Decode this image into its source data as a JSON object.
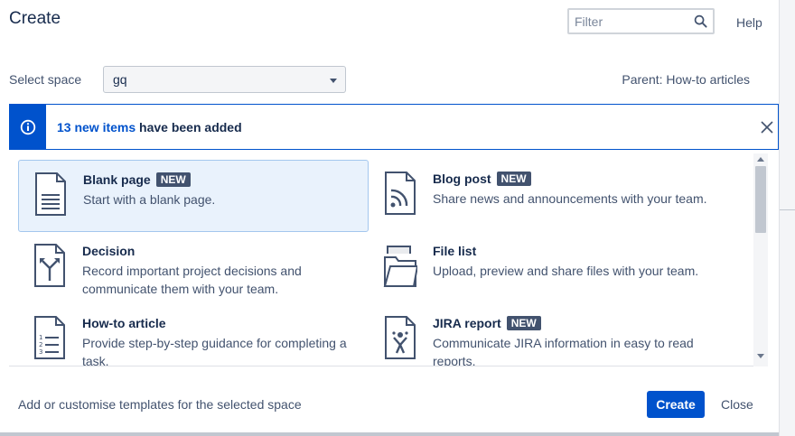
{
  "dialog": {
    "title": "Create",
    "help_label": "Help"
  },
  "filter": {
    "placeholder": "Filter",
    "value": ""
  },
  "space": {
    "label": "Select space",
    "selected": "gq",
    "parent_text": "Parent: How-to articles"
  },
  "banner": {
    "link_text": "13 new items",
    "rest_text": " have been added"
  },
  "templates": [
    {
      "name": "Blank page",
      "badge": "NEW",
      "description": "Start with a blank page.",
      "icon": "blank-page-icon",
      "selected": true
    },
    {
      "name": "Blog post",
      "badge": "NEW",
      "description": "Share news and announcements with your team.",
      "icon": "blog-post-icon",
      "selected": false
    },
    {
      "name": "Decision",
      "badge": "",
      "description": "Record important project decisions and communicate them with your team.",
      "icon": "decision-icon",
      "selected": false
    },
    {
      "name": "File list",
      "badge": "",
      "description": "Upload, preview and share files with your team.",
      "icon": "file-list-icon",
      "selected": false
    },
    {
      "name": "How-to article",
      "badge": "",
      "description": "Provide step-by-step guidance for completing a task.",
      "icon": "how-to-article-icon",
      "selected": false
    },
    {
      "name": "JIRA report",
      "badge": "NEW",
      "description": "Communicate JIRA information in easy to read reports.",
      "icon": "jira-report-icon",
      "selected": false
    }
  ],
  "footer": {
    "customise_link": "Add or customise templates for the selected space",
    "create_label": "Create",
    "close_label": "Close"
  },
  "colors": {
    "primary": "#0052cc",
    "badge": "#42526e",
    "selected_bg": "#e9f2fc"
  }
}
